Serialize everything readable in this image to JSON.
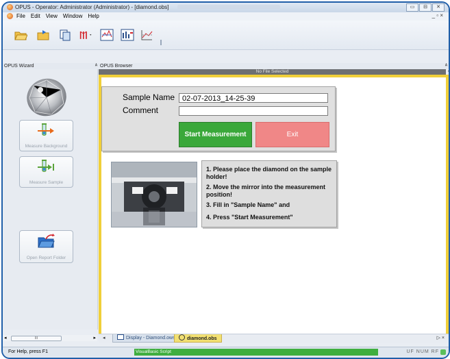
{
  "window": {
    "title": "OPUS - Operator: Administrator  (Administrator) - [diamond.obs]",
    "buttons": [
      "▭",
      "⊟",
      "✕"
    ]
  },
  "menubar": {
    "items": [
      "File",
      "Edit",
      "View",
      "Window",
      "Help"
    ],
    "mdi_controls": "_ ▫ ×"
  },
  "toolbar": {
    "icons": [
      "open-folder-icon",
      "open-file-icon",
      "copy-icon",
      "spectrum-peaks-icon",
      "display-spectrum-icon",
      "zoom-spectrum-icon",
      "plot-icon"
    ]
  },
  "panels": {
    "wizard_title": "OPUS Wizard",
    "browser_title": "OPUS Browser",
    "pin": "ᴬ",
    "no_file": "No File Selected"
  },
  "wizard": {
    "buttons": [
      {
        "label": "Measure Background"
      },
      {
        "label": "Measure Sample"
      },
      {
        "label": "Open Report Folder"
      }
    ]
  },
  "form": {
    "sample_name_label": "Sample Name",
    "sample_name_value": "02-07-2013_14-25-39",
    "comment_label": "Comment",
    "comment_value": "",
    "start_label": "Start Measurement",
    "exit_label": "Exit"
  },
  "instructions": [
    "1. Please place the diamond on the sample holder!",
    "2. Move the mirror into the measurement position!",
    "3. Fill in \"Sample Name\" and",
    "4. Press \"Start Measurement\""
  ],
  "tabs": {
    "inactive": "Display - Diamond.ows",
    "active": "diamond.obs",
    "nav_left": "◂",
    "nav_right": "▷ ×"
  },
  "scroll": {
    "thumb": "III",
    "left": "◂",
    "right": "▸"
  },
  "status": {
    "help": "For Help, press F1",
    "script": "VisualBasic Script",
    "indicators": "UF NUM RF"
  }
}
